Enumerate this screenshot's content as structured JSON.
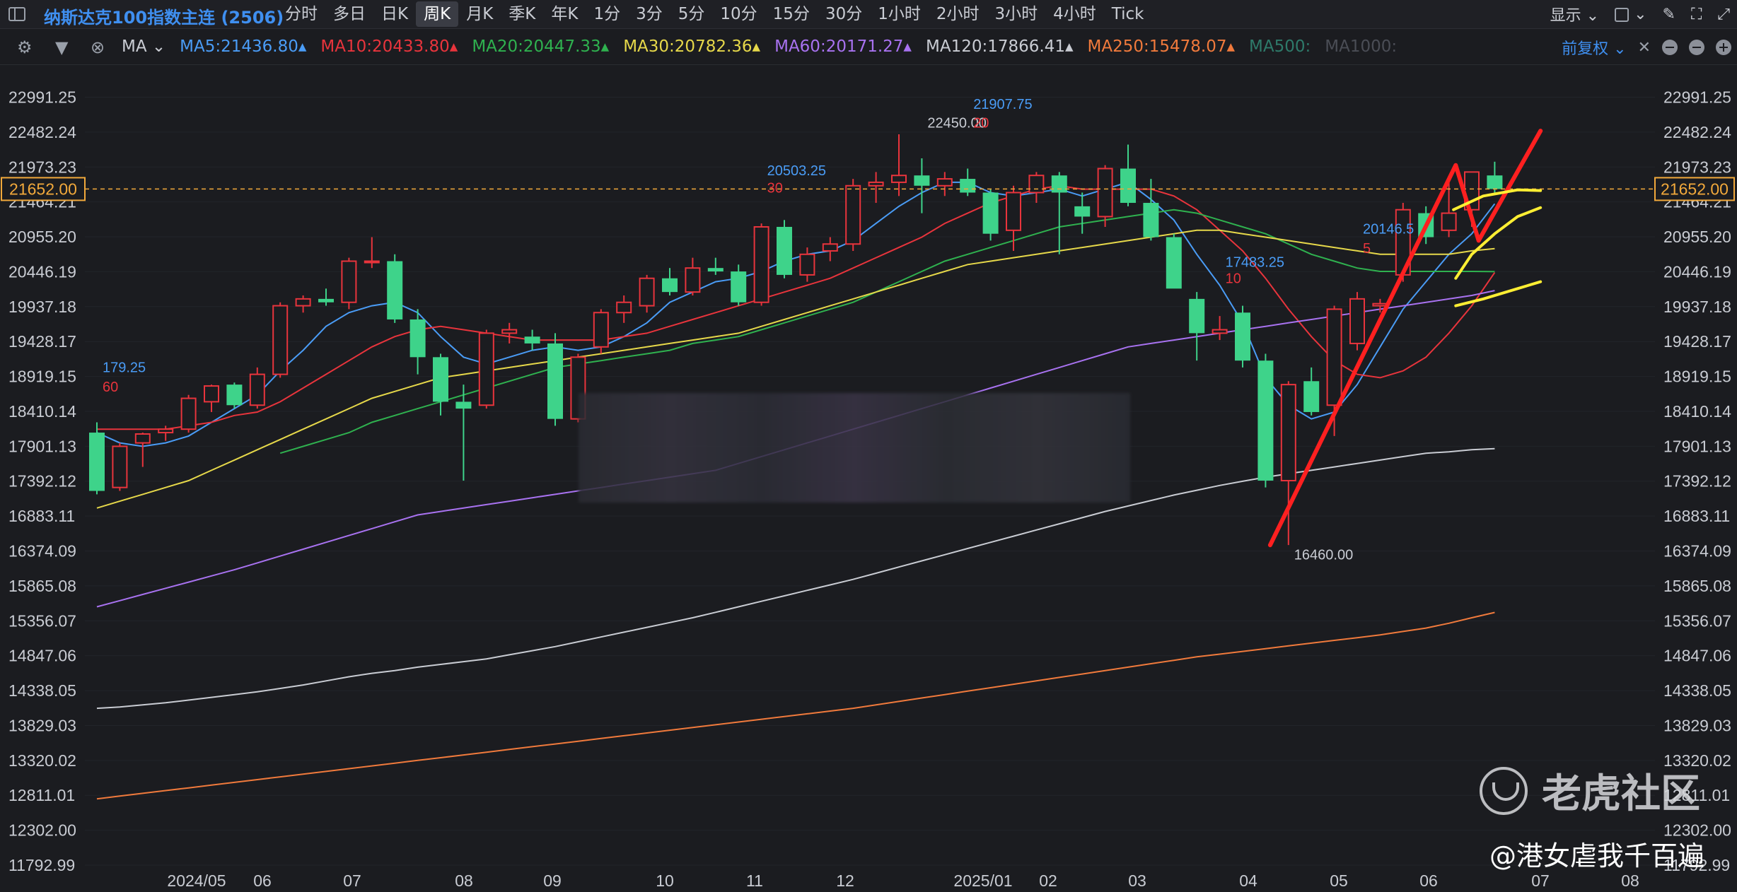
{
  "header": {
    "title": "纳斯达克100指数主连 (2506)",
    "periods": [
      "分时",
      "多日",
      "日K",
      "周K",
      "月K",
      "季K",
      "年K",
      "1分",
      "3分",
      "5分",
      "10分",
      "15分",
      "30分",
      "1小时",
      "2小时",
      "3小时",
      "4小时",
      "Tick"
    ],
    "active_period": "周K",
    "display_label": "显示"
  },
  "ma_bar": {
    "type_label": "MA",
    "items": [
      {
        "label": "MA5:21436.80",
        "color": "#4a9cf6"
      },
      {
        "label": "MA10:20433.80",
        "color": "#e8343c"
      },
      {
        "label": "MA20:20447.33",
        "color": "#2fb14f"
      },
      {
        "label": "MA30:20782.36",
        "color": "#e6d84a"
      },
      {
        "label": "MA60:20171.27",
        "color": "#a872f0"
      },
      {
        "label": "MA120:17866.41",
        "color": "#c9ccd3"
      },
      {
        "label": "MA250:15478.07",
        "color": "#f07a3c"
      },
      {
        "label": "MA500:",
        "color": "#2e7a6a"
      },
      {
        "label": "MA1000:",
        "color": "#4a4d55"
      }
    ],
    "adjust_label": "前复权"
  },
  "colors": {
    "up": "#e8343c",
    "down": "#3ed38a",
    "price_line": "#f2a93b",
    "ma120": "#c9ccd3"
  },
  "current_price": "21652.00",
  "watermark": {
    "brand": "老虎社区",
    "author": "@港女虐我千百遍"
  },
  "chart_data": {
    "type": "line",
    "y_ticks": [
      22991.25,
      22482.24,
      21973.23,
      21464.21,
      20955.2,
      20446.19,
      19937.18,
      19428.17,
      18919.15,
      18410.14,
      17901.13,
      17392.12,
      16883.11,
      16374.09,
      15865.08,
      15356.07,
      14847.06,
      14338.05,
      13829.03,
      13320.02,
      12811.01,
      12302.0,
      11792.99
    ],
    "y_labels": [
      "22991.25",
      "22482.24",
      "21973.23",
      "21464.21",
      "20955.20",
      "20446.19",
      "19937.18",
      "19428.17",
      "18919.15",
      "18410.14",
      "17901.13",
      "17392.12",
      "16883.11",
      "16374.09",
      "15865.08",
      "15356.07",
      "14847.06",
      "14338.05",
      "13829.03",
      "13320.02",
      "12811.01",
      "12302.00",
      "11792.99"
    ],
    "ylim": [
      11792.99,
      23460
    ],
    "x_labels": [
      "2024/05",
      "06",
      "07",
      "08",
      "09",
      "10",
      "11",
      "12",
      "2025/01",
      "02",
      "03",
      "04",
      "05",
      "06",
      "07",
      "08"
    ],
    "candles": [
      {
        "o": 18100,
        "h": 18250,
        "l": 17200,
        "c": 17250
      },
      {
        "o": 17300,
        "h": 17950,
        "l": 17250,
        "c": 17900
      },
      {
        "o": 17950,
        "h": 18100,
        "l": 17600,
        "c": 18080
      },
      {
        "o": 18100,
        "h": 18200,
        "l": 17980,
        "c": 18150
      },
      {
        "o": 18150,
        "h": 18650,
        "l": 18100,
        "c": 18600
      },
      {
        "o": 18550,
        "h": 18800,
        "l": 18400,
        "c": 18780
      },
      {
        "o": 18800,
        "h": 18830,
        "l": 18450,
        "c": 18500
      },
      {
        "o": 18500,
        "h": 19050,
        "l": 18450,
        "c": 18950
      },
      {
        "o": 18950,
        "h": 20000,
        "l": 18900,
        "c": 19950
      },
      {
        "o": 19950,
        "h": 20100,
        "l": 19850,
        "c": 20050
      },
      {
        "o": 20050,
        "h": 20200,
        "l": 19950,
        "c": 20000
      },
      {
        "o": 20000,
        "h": 20650,
        "l": 19900,
        "c": 20600
      },
      {
        "o": 20600,
        "h": 20950,
        "l": 20500,
        "c": 20600
      },
      {
        "o": 20600,
        "h": 20700,
        "l": 19700,
        "c": 19750
      },
      {
        "o": 19750,
        "h": 19900,
        "l": 18950,
        "c": 19200
      },
      {
        "o": 19200,
        "h": 19250,
        "l": 18350,
        "c": 18550
      },
      {
        "o": 18550,
        "h": 18800,
        "l": 17400,
        "c": 18450
      },
      {
        "o": 18500,
        "h": 19600,
        "l": 18450,
        "c": 19550
      },
      {
        "o": 19550,
        "h": 19700,
        "l": 19400,
        "c": 19600
      },
      {
        "o": 19500,
        "h": 19600,
        "l": 19300,
        "c": 19400
      },
      {
        "o": 19400,
        "h": 19550,
        "l": 18200,
        "c": 18300
      },
      {
        "o": 18300,
        "h": 19250,
        "l": 18250,
        "c": 19200
      },
      {
        "o": 19350,
        "h": 19900,
        "l": 19250,
        "c": 19850
      },
      {
        "o": 19850,
        "h": 20100,
        "l": 19700,
        "c": 20000
      },
      {
        "o": 19950,
        "h": 20400,
        "l": 19850,
        "c": 20350
      },
      {
        "o": 20350,
        "h": 20500,
        "l": 20100,
        "c": 20150
      },
      {
        "o": 20150,
        "h": 20650,
        "l": 20100,
        "c": 20500
      },
      {
        "o": 20500,
        "h": 20650,
        "l": 20400,
        "c": 20450
      },
      {
        "o": 20450,
        "h": 20550,
        "l": 19950,
        "c": 20000
      },
      {
        "o": 20000,
        "h": 21150,
        "l": 19950,
        "c": 21100
      },
      {
        "o": 21100,
        "h": 21200,
        "l": 20350,
        "c": 20400
      },
      {
        "o": 20400,
        "h": 20800,
        "l": 20300,
        "c": 20700
      },
      {
        "o": 20750,
        "h": 20950,
        "l": 20600,
        "c": 20850
      },
      {
        "o": 20850,
        "h": 21800,
        "l": 20750,
        "c": 21700
      },
      {
        "o": 21700,
        "h": 21900,
        "l": 21450,
        "c": 21750
      },
      {
        "o": 21750,
        "h": 22450,
        "l": 21550,
        "c": 21850
      },
      {
        "o": 21850,
        "h": 22100,
        "l": 21300,
        "c": 21700
      },
      {
        "o": 21700,
        "h": 21900,
        "l": 21550,
        "c": 21800
      },
      {
        "o": 21800,
        "h": 21950,
        "l": 21550,
        "c": 21600
      },
      {
        "o": 21600,
        "h": 21650,
        "l": 20900,
        "c": 21000
      },
      {
        "o": 21050,
        "h": 21700,
        "l": 20750,
        "c": 21600
      },
      {
        "o": 21600,
        "h": 21900,
        "l": 21450,
        "c": 21850
      },
      {
        "o": 21850,
        "h": 21900,
        "l": 20700,
        "c": 21600
      },
      {
        "o": 21400,
        "h": 21600,
        "l": 21000,
        "c": 21250
      },
      {
        "o": 21250,
        "h": 22000,
        "l": 21100,
        "c": 21950
      },
      {
        "o": 21950,
        "h": 22300,
        "l": 21400,
        "c": 21450
      },
      {
        "o": 21450,
        "h": 21800,
        "l": 20900,
        "c": 20950
      },
      {
        "o": 20950,
        "h": 21000,
        "l": 20250,
        "c": 20200
      },
      {
        "o": 20050,
        "h": 20150,
        "l": 19150,
        "c": 19550
      },
      {
        "o": 19550,
        "h": 19800,
        "l": 19450,
        "c": 19600
      },
      {
        "o": 19850,
        "h": 19950,
        "l": 19050,
        "c": 19150
      },
      {
        "o": 19150,
        "h": 19250,
        "l": 17300,
        "c": 17400
      },
      {
        "o": 17400,
        "h": 18850,
        "l": 16460,
        "c": 18800
      },
      {
        "o": 18850,
        "h": 19050,
        "l": 18350,
        "c": 18400
      },
      {
        "o": 18500,
        "h": 19950,
        "l": 18050,
        "c": 19900
      },
      {
        "o": 19400,
        "h": 20150,
        "l": 19300,
        "c": 20050
      },
      {
        "o": 19950,
        "h": 20050,
        "l": 19850,
        "c": 19980
      },
      {
        "o": 20400,
        "h": 21450,
        "l": 20300,
        "c": 21350
      },
      {
        "o": 21300,
        "h": 21400,
        "l": 20850,
        "c": 20950
      },
      {
        "o": 21050,
        "h": 21800,
        "l": 20950,
        "c": 21300
      },
      {
        "o": 21350,
        "h": 21900,
        "l": 21100,
        "c": 21900
      },
      {
        "o": 21850,
        "h": 22050,
        "l": 21600,
        "c": 21652
      }
    ],
    "series": [
      {
        "name": "MA5",
        "color": "#4a9cf6",
        "values": [
          18100,
          17950,
          17900,
          17950,
          18050,
          18250,
          18450,
          18650,
          19000,
          19300,
          19650,
          19850,
          19950,
          20000,
          19850,
          19500,
          19200,
          19100,
          19200,
          19300,
          19350,
          19300,
          19350,
          19500,
          19700,
          20000,
          20150,
          20300,
          20350,
          20450,
          20600,
          20700,
          20750,
          20900,
          21150,
          21400,
          21600,
          21750,
          21750,
          21600,
          21550,
          21600,
          21650,
          21550,
          21650,
          21750,
          21500,
          21200,
          20700,
          20250,
          19700,
          18900,
          18500,
          18300,
          18400,
          18800,
          19350,
          19900,
          20300,
          20700,
          21000,
          21436.8
        ]
      },
      {
        "name": "MA10",
        "color": "#e8343c",
        "values": [
          18150,
          18150,
          18150,
          18150,
          18200,
          18250,
          18350,
          18400,
          18550,
          18750,
          18950,
          19150,
          19350,
          19500,
          19600,
          19650,
          19600,
          19550,
          19500,
          19450,
          19450,
          19450,
          19450,
          19500,
          19550,
          19650,
          19750,
          19850,
          19950,
          20050,
          20150,
          20250,
          20350,
          20500,
          20650,
          20800,
          20950,
          21150,
          21300,
          21450,
          21550,
          21650,
          21700,
          21650,
          21650,
          21650,
          21650,
          21550,
          21350,
          21050,
          20750,
          20350,
          19900,
          19500,
          19150,
          18950,
          18900,
          19000,
          19200,
          19550,
          19950,
          20433.8
        ]
      },
      {
        "name": "MA20",
        "color": "#2fb14f",
        "values": [
          null,
          null,
          null,
          null,
          null,
          null,
          null,
          null,
          17800,
          17900,
          18000,
          18100,
          18250,
          18350,
          18450,
          18550,
          18650,
          18750,
          18850,
          18950,
          19050,
          19100,
          19150,
          19200,
          19250,
          19300,
          19400,
          19450,
          19500,
          19600,
          19700,
          19800,
          19900,
          20000,
          20150,
          20300,
          20450,
          20600,
          20700,
          20800,
          20900,
          21000,
          21100,
          21150,
          21200,
          21250,
          21300,
          21350,
          21300,
          21200,
          21100,
          21000,
          20850,
          20700,
          20600,
          20500,
          20450,
          20450,
          20450,
          20450,
          20450,
          20447.33
        ]
      },
      {
        "name": "MA30",
        "color": "#e6d84a",
        "values": [
          17000,
          17100,
          17200,
          17300,
          17400,
          17550,
          17700,
          17850,
          18000,
          18150,
          18300,
          18450,
          18600,
          18700,
          18800,
          18900,
          18950,
          19000,
          19050,
          19100,
          19150,
          19200,
          19250,
          19300,
          19350,
          19400,
          19450,
          19500,
          19550,
          19650,
          19750,
          19850,
          19950,
          20050,
          20150,
          20250,
          20350,
          20450,
          20550,
          20600,
          20650,
          20700,
          20750,
          20800,
          20850,
          20900,
          20950,
          21000,
          21050,
          21050,
          21000,
          20950,
          20900,
          20850,
          20800,
          20750,
          20700,
          20700,
          20700,
          20700,
          20750,
          20782.36
        ]
      },
      {
        "name": "MA60",
        "color": "#a872f0",
        "values": [
          15560,
          15650,
          15740,
          15830,
          15920,
          16010,
          16100,
          16200,
          16300,
          16400,
          16500,
          16600,
          16700,
          16800,
          16900,
          16950,
          17000,
          17050,
          17100,
          17150,
          17200,
          17250,
          17300,
          17350,
          17400,
          17450,
          17500,
          17550,
          17650,
          17750,
          17850,
          17950,
          18050,
          18150,
          18250,
          18350,
          18450,
          18550,
          18650,
          18750,
          18850,
          18950,
          19050,
          19150,
          19250,
          19350,
          19400,
          19450,
          19500,
          19550,
          19600,
          19650,
          19700,
          19750,
          19800,
          19850,
          19900,
          19950,
          20000,
          20050,
          20100,
          20171.27
        ]
      },
      {
        "name": "MA120",
        "color": "#c9ccd3",
        "values": [
          14080,
          14100,
          14130,
          14160,
          14200,
          14240,
          14280,
          14320,
          14370,
          14420,
          14480,
          14540,
          14590,
          14630,
          14680,
          14720,
          14760,
          14800,
          14860,
          14920,
          14980,
          15050,
          15120,
          15190,
          15260,
          15330,
          15400,
          15480,
          15560,
          15640,
          15720,
          15800,
          15880,
          15960,
          16050,
          16140,
          16230,
          16320,
          16410,
          16500,
          16590,
          16680,
          16770,
          16860,
          16950,
          17030,
          17110,
          17190,
          17260,
          17330,
          17390,
          17450,
          17500,
          17550,
          17600,
          17650,
          17700,
          17750,
          17800,
          17820,
          17850,
          17866.41
        ]
      },
      {
        "name": "MA250",
        "color": "#f07a3c",
        "values": [
          12760,
          12800,
          12840,
          12880,
          12920,
          12960,
          13000,
          13040,
          13080,
          13120,
          13160,
          13200,
          13240,
          13280,
          13320,
          13360,
          13400,
          13440,
          13480,
          13520,
          13560,
          13600,
          13640,
          13680,
          13720,
          13760,
          13800,
          13840,
          13880,
          13920,
          13960,
          14000,
          14040,
          14080,
          14130,
          14180,
          14230,
          14280,
          14330,
          14380,
          14430,
          14480,
          14530,
          14580,
          14630,
          14680,
          14730,
          14780,
          14830,
          14870,
          14910,
          14950,
          14990,
          15030,
          15070,
          15110,
          15150,
          15200,
          15250,
          15320,
          15400,
          15478.07
        ]
      }
    ],
    "annotations": [
      {
        "text": "179.25",
        "i": 0,
        "v": 18980,
        "color": "#4a9cf6"
      },
      {
        "text": "60",
        "i": 0,
        "v": 18700,
        "color": "#e8343c"
      },
      {
        "text": "20503.25",
        "i": 29,
        "v": 21850,
        "color": "#4a9cf6"
      },
      {
        "text": "30",
        "i": 29,
        "v": 21600,
        "color": "#e8343c"
      },
      {
        "text": "22450.00",
        "i": 36,
        "v": 22550,
        "color": "#c9ccd3"
      },
      {
        "text": "21907.75",
        "i": 38,
        "v": 22820,
        "color": "#4a9cf6"
      },
      {
        "text": "20",
        "i": 38,
        "v": 22550,
        "color": "#e8343c"
      },
      {
        "text": "17483.25",
        "i": 49,
        "v": 20520,
        "color": "#4a9cf6"
      },
      {
        "text": "10",
        "i": 49,
        "v": 20280,
        "color": "#e8343c"
      },
      {
        "text": "20146.5",
        "i": 55,
        "v": 21000,
        "color": "#4a9cf6"
      },
      {
        "text": "5",
        "i": 55,
        "v": 20720,
        "color": "#e8343c"
      },
      {
        "text": "16460.00",
        "i": 52,
        "v": 16250,
        "color": "#c9ccd3"
      }
    ],
    "drawings": [
      {
        "color": "#ff2020",
        "points": [
          [
            51.2,
            16460
          ],
          [
            59.3,
            22000
          ],
          [
            60.3,
            20900
          ],
          [
            63.0,
            22500
          ]
        ]
      },
      {
        "color": "#ffee33",
        "points": [
          [
            59.2,
            21350
          ],
          [
            60.5,
            21550
          ],
          [
            62.0,
            21640
          ],
          [
            63.0,
            21630
          ]
        ]
      },
      {
        "color": "#ffee33",
        "points": [
          [
            59.3,
            20350
          ],
          [
            60.0,
            20700
          ],
          [
            61.0,
            21000
          ],
          [
            62.0,
            21250
          ],
          [
            63.0,
            21380
          ]
        ]
      },
      {
        "color": "#ffee33",
        "points": [
          [
            59.3,
            19950
          ],
          [
            60.5,
            20050
          ],
          [
            62.0,
            20200
          ],
          [
            63.0,
            20300
          ]
        ]
      }
    ]
  }
}
